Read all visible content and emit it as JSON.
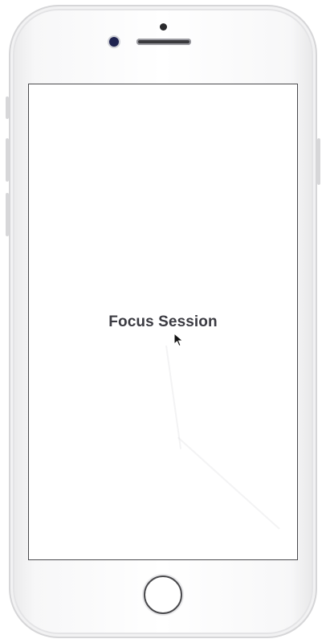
{
  "screen": {
    "title": "Focus Session"
  },
  "device": {
    "color": "#f5f5f6",
    "outline_color": "#d6d6d8"
  },
  "icons": {
    "cursor": "pointer-cursor-icon",
    "home": "home-button-icon"
  },
  "colors": {
    "title_text": "#3b3b42",
    "screen_border": "#4a4a4d"
  }
}
